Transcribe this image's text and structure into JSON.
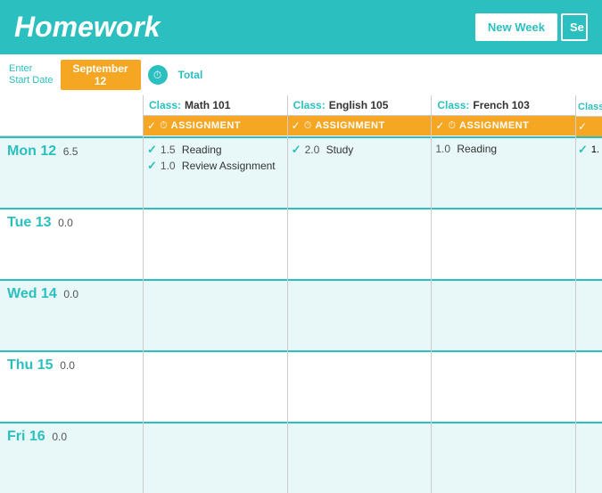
{
  "header": {
    "title": "Homework",
    "new_week_label": "New Week",
    "search_label": "Se"
  },
  "subheader": {
    "enter_start_date_line1": "Enter",
    "enter_start_date_line2": "Start Date",
    "date_value": "September  12",
    "total_label": "Total"
  },
  "classes": [
    {
      "label": "Class:",
      "name": "Math 101"
    },
    {
      "label": "Class:",
      "name": "English 105"
    },
    {
      "label": "Class:",
      "name": "French 103"
    },
    {
      "label": "Class:",
      "name": ""
    }
  ],
  "assignment_row_label": "ASSIGNMENT",
  "days": [
    {
      "name": "Mon 12",
      "total": "6.5",
      "assignments": [
        [
          {
            "done": true,
            "hours": "1.5",
            "task": "Reading"
          },
          {
            "done": true,
            "hours": "1.0",
            "task": "Review Assignment"
          }
        ],
        [
          {
            "done": true,
            "hours": "2.0",
            "task": "Study"
          }
        ],
        [
          {
            "done": false,
            "hours": "1.0",
            "task": "Reading"
          }
        ],
        [
          {
            "done": true,
            "hours": "1.",
            "task": ""
          }
        ]
      ]
    },
    {
      "name": "Tue 13",
      "total": "0.0",
      "assignments": [
        [],
        [],
        [],
        []
      ]
    },
    {
      "name": "Wed 14",
      "total": "0.0",
      "assignments": [
        [],
        [],
        [],
        []
      ]
    },
    {
      "name": "Thu 15",
      "total": "0.0",
      "assignments": [
        [],
        [],
        [],
        []
      ]
    },
    {
      "name": "Fri 16",
      "total": "0.0",
      "assignments": [
        [],
        [],
        [],
        []
      ]
    }
  ]
}
